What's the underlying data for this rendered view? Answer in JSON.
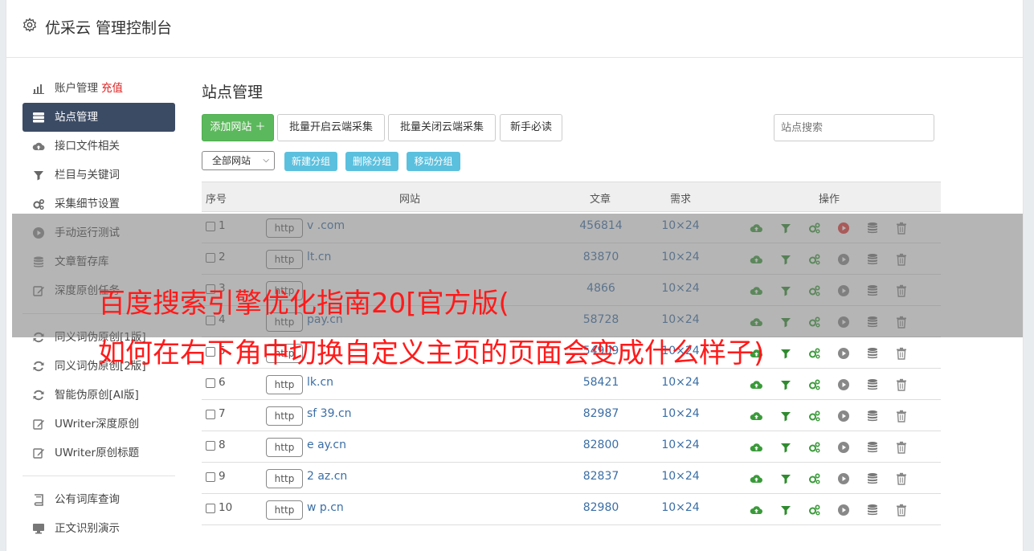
{
  "app": {
    "title": "优采云 管理控制台"
  },
  "sidebar": {
    "items": [
      {
        "label": "账户管理",
        "extra": "充值",
        "icon": "bar-chart-icon"
      },
      {
        "label": "站点管理",
        "icon": "server-icon",
        "active": true
      },
      {
        "label": "接口文件相关",
        "icon": "cloud-upload-icon"
      },
      {
        "label": "栏目与关键词",
        "icon": "filter-icon"
      },
      {
        "label": "采集细节设置",
        "icon": "cogs-icon"
      },
      {
        "label": "手动运行测试",
        "icon": "play-circle-icon"
      },
      {
        "label": "文章暂存库",
        "icon": "database-icon"
      },
      {
        "label": "深度原创任务",
        "icon": "edit-icon"
      },
      {
        "label": "同义词伪原创[1版]",
        "icon": "refresh-icon"
      },
      {
        "label": "同义词伪原创[2版]",
        "icon": "refresh-icon"
      },
      {
        "label": "智能伪原创[AI版]",
        "icon": "refresh-icon"
      },
      {
        "label": "UWriter深度原创",
        "icon": "edit-icon"
      },
      {
        "label": "UWriter原创标题",
        "icon": "edit-icon"
      },
      {
        "label": "公有词库查询",
        "icon": "book-icon"
      },
      {
        "label": "正文识别演示",
        "icon": "monitor-icon"
      }
    ]
  },
  "main": {
    "page_title": "站点管理",
    "buttons": {
      "add_site": "添加网站 ＋",
      "batch_open": "批量开启云端采集",
      "batch_close": "批量关闭云端采集",
      "newbie": "新手必读"
    },
    "search_placeholder": "站点搜索",
    "group_select": "全部网站",
    "group_buttons": {
      "new": "新建分组",
      "delete": "删除分组",
      "move": "移动分组"
    },
    "table": {
      "headers": {
        "index": "序号",
        "site": "网站",
        "articles": "文章",
        "need": "需求",
        "ops": "操作"
      },
      "rows": [
        {
          "num": "1",
          "proto": "http",
          "site": "v            .com",
          "articles": "456814",
          "need": "10×24",
          "play_red": true
        },
        {
          "num": "2",
          "proto": "http",
          "site": "       lt.cn",
          "articles": "83870",
          "need": "10×24"
        },
        {
          "num": "3",
          "proto": "http",
          "site": "",
          "articles": "4866",
          "need": "10×24"
        },
        {
          "num": "4",
          "proto": "http",
          "site": "       pay.cn",
          "articles": "58728",
          "need": "10×24"
        },
        {
          "num": "5",
          "proto": "http",
          "site": "",
          "articles": "54909",
          "need": "10×24"
        },
        {
          "num": "6",
          "proto": "http",
          "site": "       lk.cn",
          "articles": "58421",
          "need": "10×24"
        },
        {
          "num": "7",
          "proto": "http",
          "site": "sf   39.cn",
          "articles": "82987",
          "need": "10×24"
        },
        {
          "num": "8",
          "proto": "http",
          "site": "e      ay.cn",
          "articles": "82800",
          "need": "10×24"
        },
        {
          "num": "9",
          "proto": "http",
          "site": "2      az.cn",
          "articles": "82837",
          "need": "10×24"
        },
        {
          "num": "10",
          "proto": "http",
          "site": "w      p.cn",
          "articles": "82980",
          "need": "10×24"
        }
      ]
    }
  },
  "overlay": {
    "line1": "百度搜索引擎优化指南20[官方版(",
    "line2": "如何在右下角中切换自定义主页的页面会变成什么样子)"
  },
  "colors": {
    "sidebar_active": "#3c4b64",
    "green": "#5cb85c",
    "info": "#5bc0de",
    "link": "#3a6ea5",
    "overlay_text": "#ff1a1a"
  }
}
